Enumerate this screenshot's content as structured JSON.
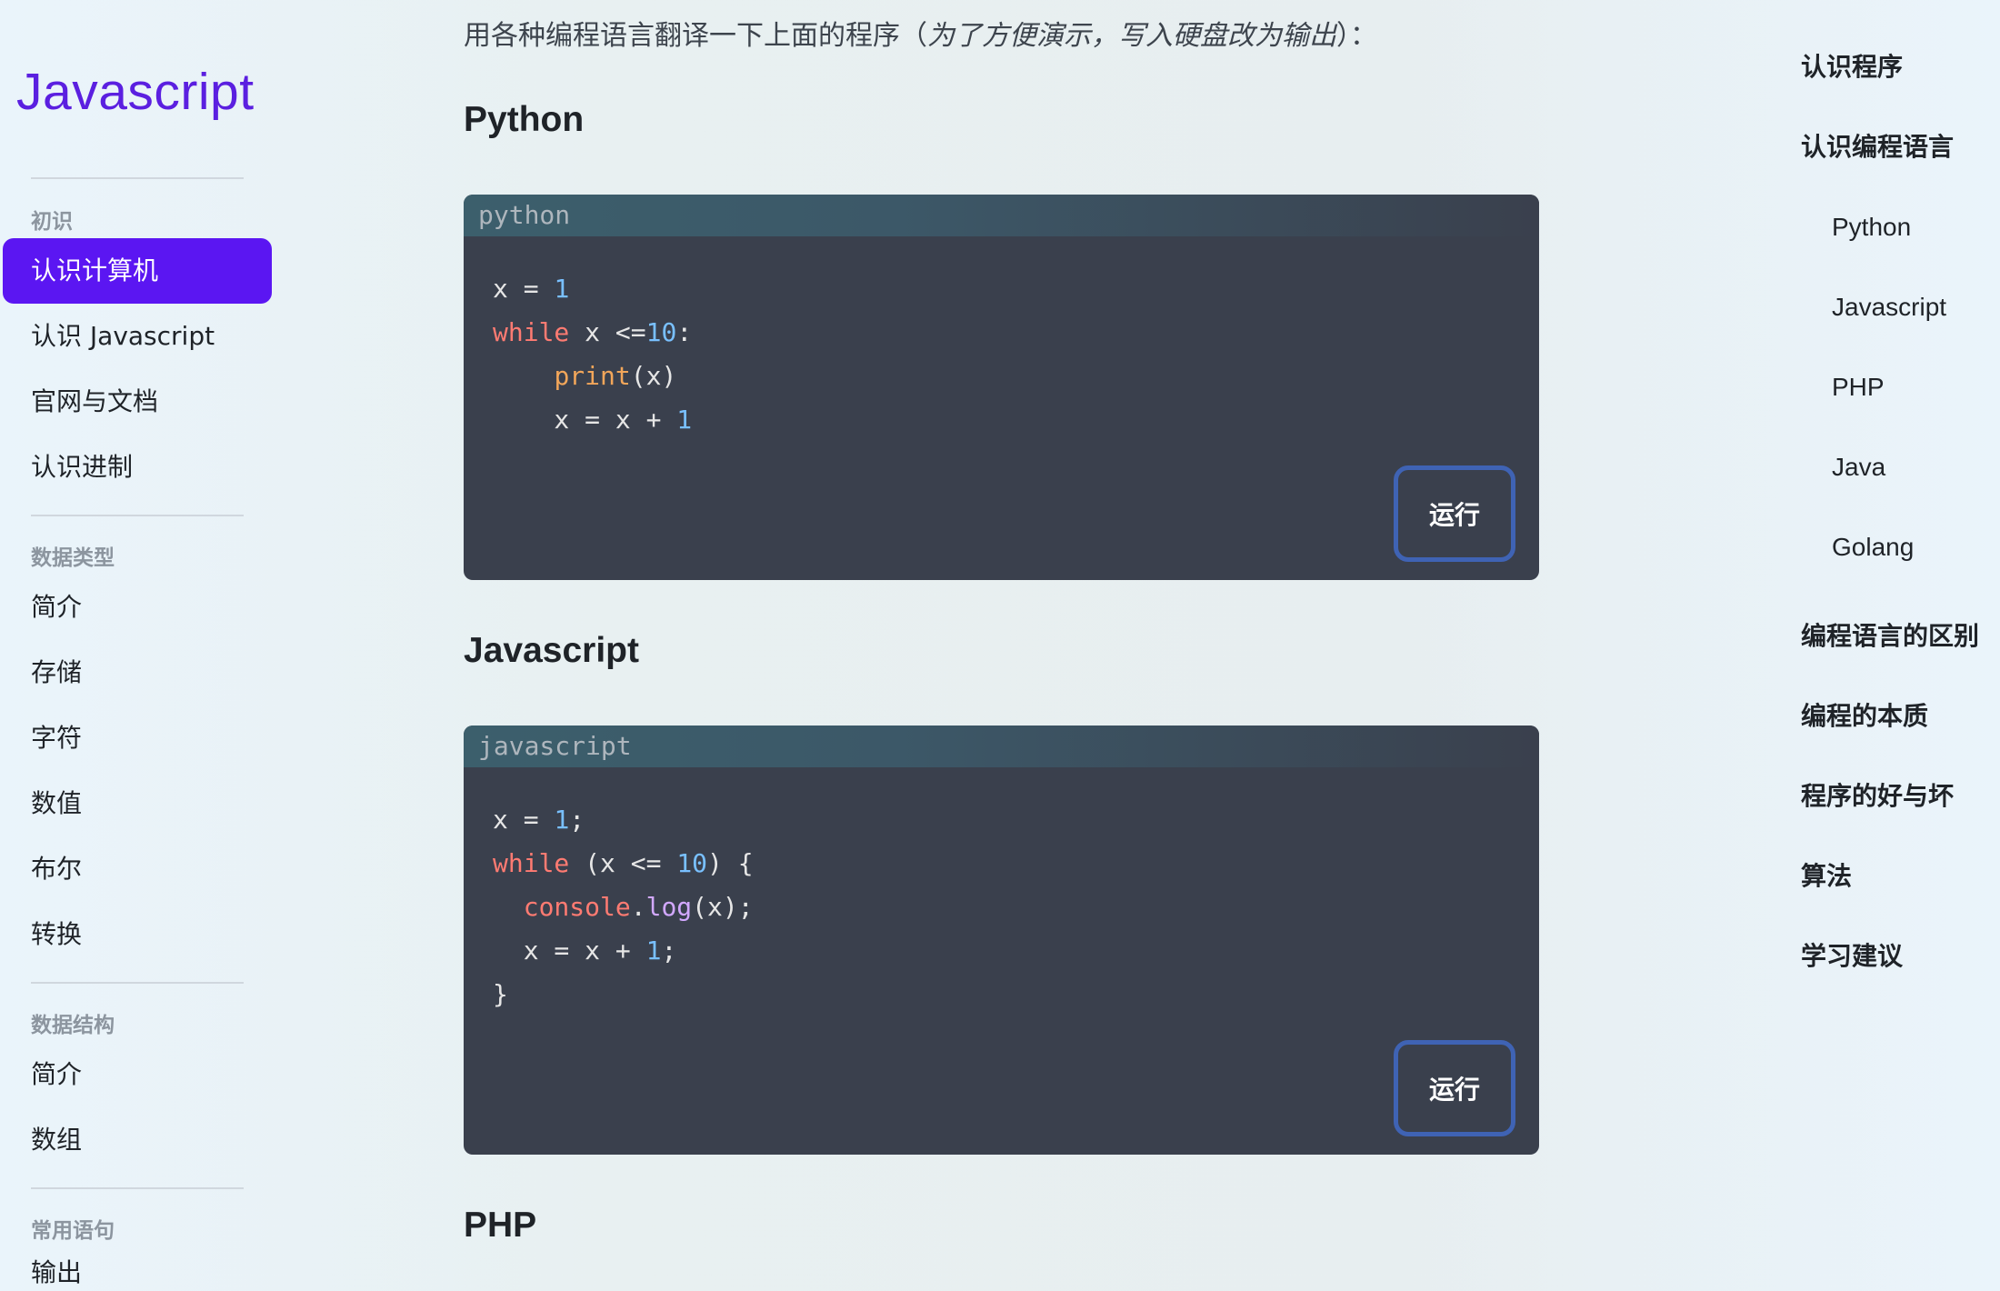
{
  "sidebar": {
    "brand": "Javascript",
    "groups": [
      {
        "title": "初识",
        "items": [
          "认识计算机",
          "认识 Javascript",
          "官网与文档",
          "认识进制"
        ]
      },
      {
        "title": "数据类型",
        "items": [
          "简介",
          "存储",
          "字符",
          "数值",
          "布尔",
          "转换"
        ]
      },
      {
        "title": "数据结构",
        "items": [
          "简介",
          "数组"
        ]
      },
      {
        "title": "常用语句",
        "items": [
          "输出"
        ]
      }
    ],
    "active_item": "认识计算机"
  },
  "main": {
    "intro_text": "用各种编程语言翻译一下上面的程序（",
    "intro_em": "为了方便演示，写入硬盘改为输出",
    "intro_end": "）：",
    "sections": [
      {
        "heading": "Python",
        "lang": "python",
        "run_label": "运行"
      },
      {
        "heading": "Javascript",
        "lang": "javascript",
        "run_label": "运行"
      },
      {
        "heading": "PHP"
      }
    ]
  },
  "toc": {
    "items": [
      {
        "label": "认识程序",
        "level": 1
      },
      {
        "label": "认识编程语言",
        "level": 1
      },
      {
        "label": "Python",
        "level": 2
      },
      {
        "label": "Javascript",
        "level": 2
      },
      {
        "label": "PHP",
        "level": 2
      },
      {
        "label": "Java",
        "level": 2
      },
      {
        "label": "Golang",
        "level": 2
      },
      {
        "label": "编程语言的区别",
        "level": 1
      },
      {
        "label": "编程的本质",
        "level": 1
      },
      {
        "label": "程序的好与坏",
        "level": 1
      },
      {
        "label": "算法",
        "level": 1
      },
      {
        "label": "学习建议",
        "level": 1
      }
    ]
  },
  "colors": {
    "accent": "#5b16f2",
    "brand": "#5b1fe0",
    "code_bg": "#3a404d",
    "run_border": "#3f63b4"
  }
}
